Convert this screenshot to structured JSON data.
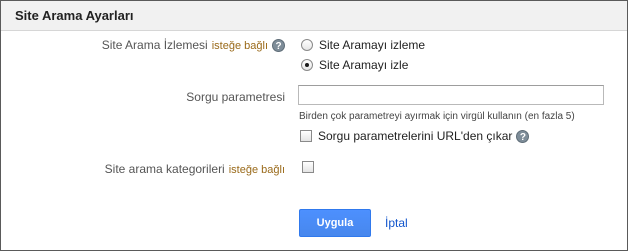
{
  "header": {
    "title": "Site Arama Ayarları"
  },
  "help_glyph": "?",
  "tracking": {
    "label": "Site Arama İzlemesi",
    "optional": "isteğe bağlı",
    "options": [
      {
        "label": "Site Aramayı izleme",
        "checked": false
      },
      {
        "label": "Site Aramayı izle",
        "checked": true
      }
    ]
  },
  "query": {
    "label": "Sorgu parametresi",
    "value": "",
    "placeholder": "",
    "hint": "Birden çok parametreyi ayırmak için virgül kullanın (en fazla 5)",
    "strip_label": "Sorgu parametrelerini URL'den çıkar"
  },
  "categories": {
    "label": "Site arama kategorileri",
    "optional": "isteğe bağlı"
  },
  "actions": {
    "apply": "Uygula",
    "cancel": "İptal"
  }
}
